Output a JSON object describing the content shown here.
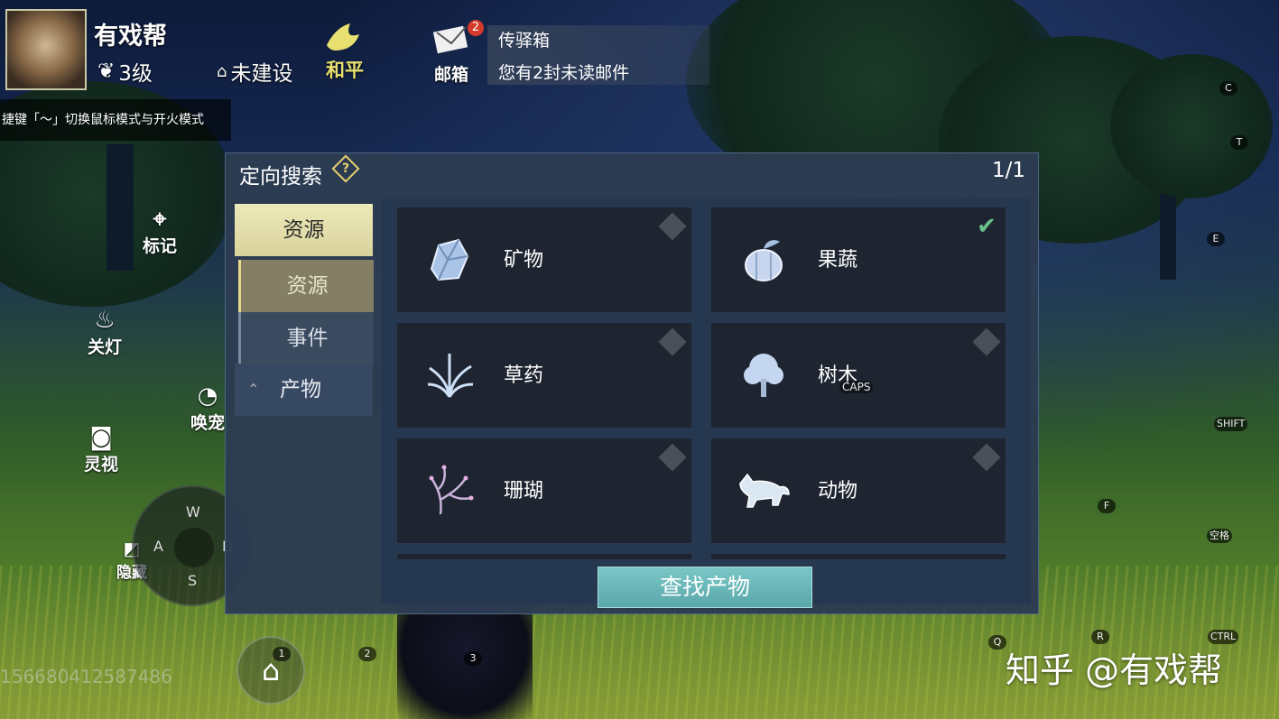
{
  "player": {
    "name": "有戏帮",
    "level": "3级",
    "guild": "未建设",
    "mode": "和平"
  },
  "hint": "捷键「～」切换鼠标模式与开火模式",
  "mail": {
    "label": "邮箱",
    "badge": "2",
    "title": "传驿箱",
    "subtitle": "您有2封未读邮件"
  },
  "side_buttons": {
    "mark": "标记",
    "light": "关灯",
    "summon": "唤宠",
    "vision": "灵视",
    "hide": "隐藏"
  },
  "dpad": {
    "up": "W",
    "left": "A",
    "right": "D",
    "down": "S"
  },
  "panel": {
    "title": "定向搜索",
    "help_symbol": "?",
    "page": "1/1",
    "tabs": [
      {
        "label": "资源",
        "state": "active"
      },
      {
        "label": "资源",
        "state": "selected-sub"
      },
      {
        "label": "事件",
        "state": "sub"
      },
      {
        "label": "产物",
        "state": "collapsible"
      }
    ],
    "items": [
      {
        "label": "矿物",
        "icon": "mineral-icon",
        "checked": false
      },
      {
        "label": "果蔬",
        "icon": "fruit-icon",
        "checked": true
      },
      {
        "label": "草药",
        "icon": "herb-icon",
        "checked": false
      },
      {
        "label": "树木",
        "icon": "tree-icon",
        "checked": false
      },
      {
        "label": "珊瑚",
        "icon": "coral-icon",
        "checked": false
      },
      {
        "label": "动物",
        "icon": "animal-icon",
        "checked": false
      }
    ],
    "find_button": "查找产物"
  },
  "player_id": "156680412587486",
  "hotbar": [
    "1",
    "2",
    "3"
  ],
  "key_hints": {
    "c": "C",
    "t": "T",
    "e": "E",
    "shift": "SHIFT",
    "f": "F",
    "space": "空格",
    "q": "Q",
    "r": "R",
    "ctrl": "CTRL",
    "caps": "CAPS"
  },
  "watermark": "知乎 @有戏帮",
  "colors": {
    "panel_bg": "#2c3c52",
    "active_tab": "#ece9b9",
    "find_button": "#6ab7b8",
    "check": "#6ac08a",
    "badge": "#d63a2a"
  }
}
